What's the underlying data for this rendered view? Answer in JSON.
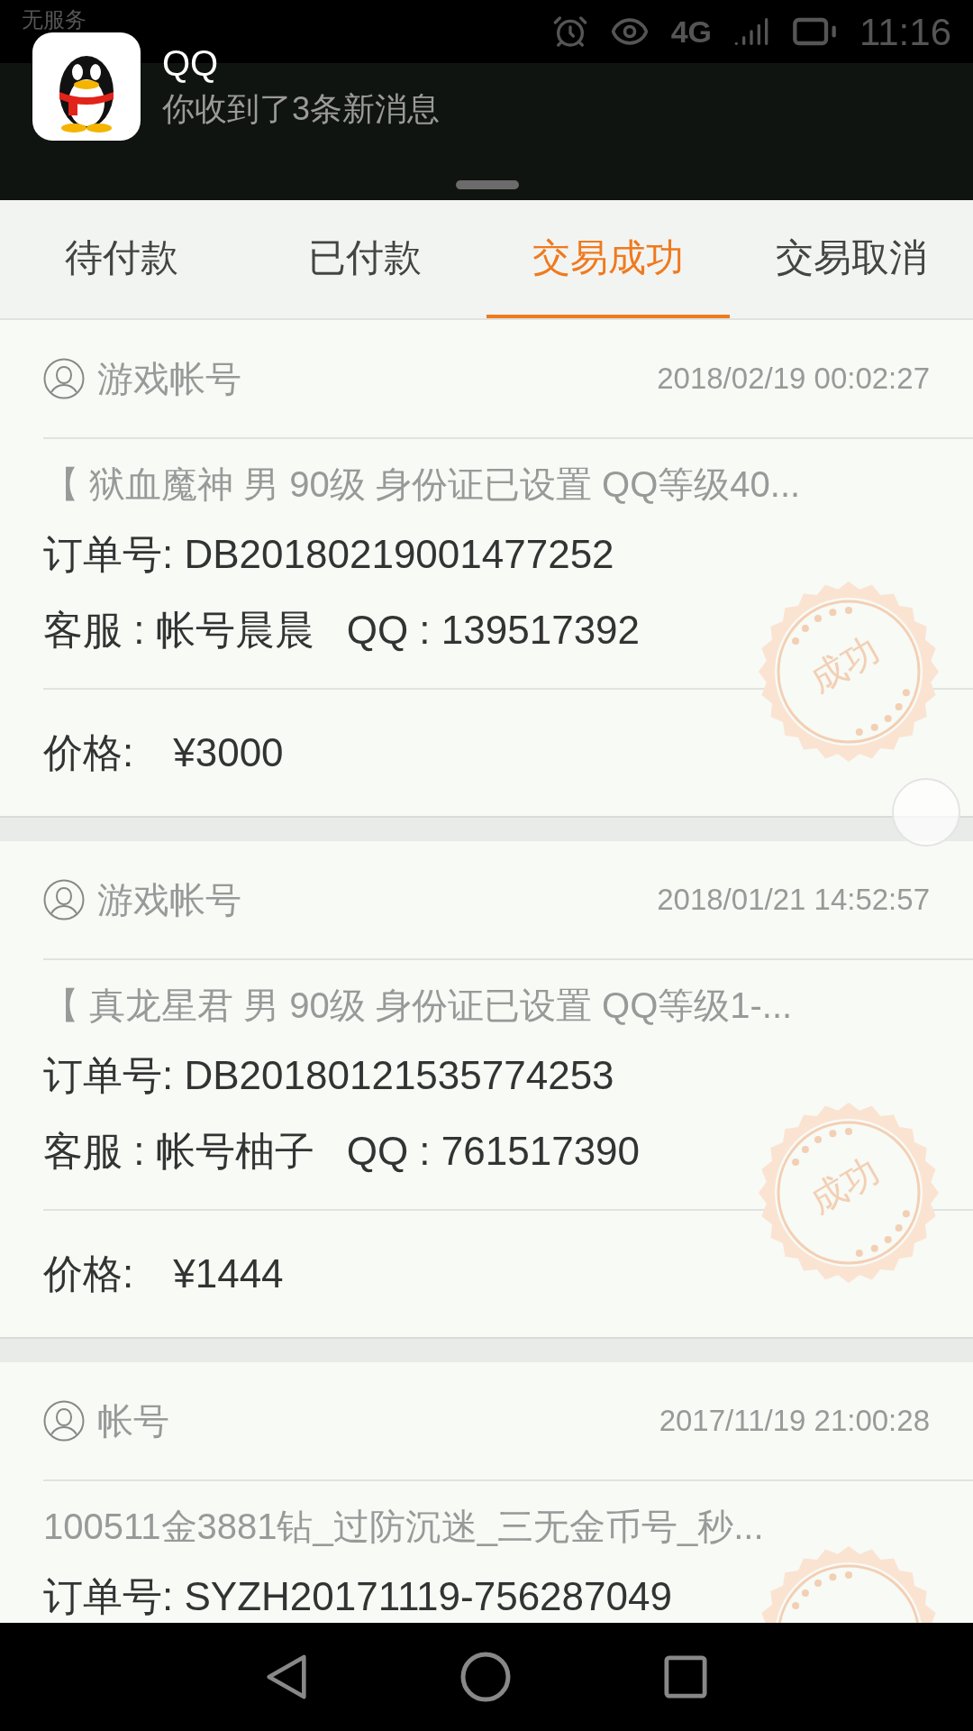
{
  "status_bar": {
    "carrier": "无服务",
    "network": "4G",
    "time": "11:16"
  },
  "notification": {
    "app": "QQ",
    "message": "你收到了3条新消息"
  },
  "tabs": [
    {
      "label": "待付款",
      "selected": false
    },
    {
      "label": "已付款",
      "selected": false
    },
    {
      "label": "交易成功",
      "selected": true
    },
    {
      "label": "交易取消",
      "selected": false
    }
  ],
  "orders": [
    {
      "category": "游戏帐号",
      "date": "2018/02/19 00:02:27",
      "title": "【 狱血魔神 男 90级 身份证已设置 QQ等级40...",
      "order_no_label": "订单号:",
      "order_no": "DB20180219001477252",
      "service_label": "客服 :",
      "service": "帐号晨晨",
      "qq_label": "QQ :",
      "qq": "139517392",
      "price_label": "价格:",
      "price": "¥3000",
      "stamped": true,
      "stamp": "成功"
    },
    {
      "category": "游戏帐号",
      "date": "2018/01/21 14:52:57",
      "title": "【 真龙星君 男 90级 身份证已设置 QQ等级1-...",
      "order_no_label": "订单号:",
      "order_no": "DB20180121535774253",
      "service_label": "客服 :",
      "service": "帐号柚子",
      "qq_label": "QQ :",
      "qq": "761517390",
      "price_label": "价格:",
      "price": "¥1444",
      "stamped": true,
      "stamp": "成功"
    },
    {
      "category": "帐号",
      "date": "2017/11/19 21:00:28",
      "title": "100511金3881钻_过防沉迷_三无金币号_秒...",
      "order_no_label": "订单号:",
      "order_no": "SYZH20171119-756287049",
      "stamped": true
    }
  ]
}
